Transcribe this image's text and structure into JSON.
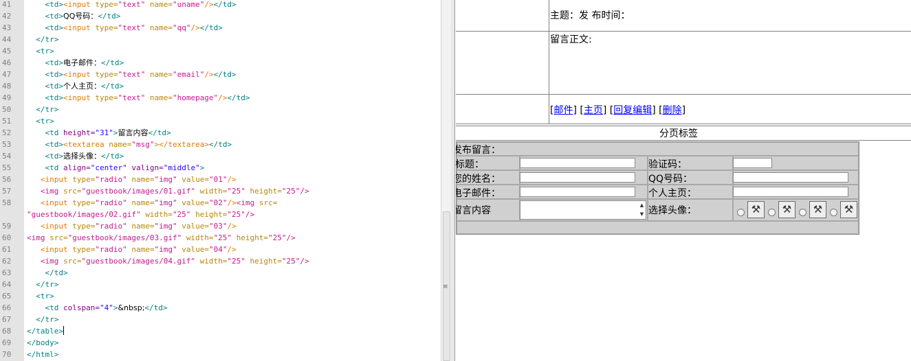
{
  "editor": {
    "lines": [
      {
        "num": "41",
        "segs": [
          [
            "t",
            "    <td>"
          ],
          [
            "ti",
            "<input "
          ],
          [
            "ta",
            "type="
          ],
          [
            "tv",
            "\"text\" "
          ],
          [
            "ta",
            "name="
          ],
          [
            "tv",
            "\"uname\""
          ],
          [
            "ti",
            "/>"
          ],
          [
            "t",
            "</td>"
          ]
        ]
      },
      {
        "num": "42",
        "segs": [
          [
            "t",
            "    <td>"
          ],
          [
            "x",
            "QQ号码："
          ],
          [
            "t",
            "</td>"
          ]
        ]
      },
      {
        "num": "43",
        "segs": [
          [
            "t",
            "    <td>"
          ],
          [
            "ti",
            "<input "
          ],
          [
            "ta",
            "type="
          ],
          [
            "tv",
            "\"text\" "
          ],
          [
            "ta",
            "name="
          ],
          [
            "tv",
            "\"qq\""
          ],
          [
            "ti",
            "/>"
          ],
          [
            "t",
            "</td>"
          ]
        ]
      },
      {
        "num": "44",
        "segs": [
          [
            "t",
            "  </tr>"
          ]
        ]
      },
      {
        "num": "45",
        "segs": [
          [
            "t",
            "  <tr>"
          ]
        ]
      },
      {
        "num": "46",
        "segs": [
          [
            "t",
            "    <td>"
          ],
          [
            "x",
            "电子邮件："
          ],
          [
            "t",
            "</td>"
          ]
        ]
      },
      {
        "num": "47",
        "segs": [
          [
            "t",
            "    <td>"
          ],
          [
            "ti",
            "<input "
          ],
          [
            "ta",
            "type="
          ],
          [
            "tv",
            "\"text\" "
          ],
          [
            "ta",
            "name="
          ],
          [
            "tv",
            "\"email\""
          ],
          [
            "ti",
            "/>"
          ],
          [
            "t",
            "</td>"
          ]
        ]
      },
      {
        "num": "48",
        "segs": [
          [
            "t",
            "    <td>"
          ],
          [
            "x",
            "个人主页："
          ],
          [
            "t",
            "</td>"
          ]
        ]
      },
      {
        "num": "49",
        "segs": [
          [
            "t",
            "    <td>"
          ],
          [
            "ti",
            "<input "
          ],
          [
            "ta",
            "type="
          ],
          [
            "tv",
            "\"text\" "
          ],
          [
            "ta",
            "name="
          ],
          [
            "tv",
            "\"homepage\""
          ],
          [
            "ti",
            "/>"
          ],
          [
            "t",
            "</td>"
          ]
        ]
      },
      {
        "num": "50",
        "segs": [
          [
            "t",
            "  </tr>"
          ]
        ]
      },
      {
        "num": "51",
        "segs": [
          [
            "t",
            "  <tr>"
          ]
        ]
      },
      {
        "num": "52",
        "segs": [
          [
            "t",
            "    <td "
          ],
          [
            "a",
            "height="
          ],
          [
            "v",
            "\"31\""
          ],
          [
            "t",
            ">"
          ],
          [
            "x",
            "留言内容"
          ],
          [
            "t",
            "</td>"
          ]
        ]
      },
      {
        "num": "53",
        "segs": [
          [
            "t",
            "    <td>"
          ],
          [
            "ti",
            "<textarea "
          ],
          [
            "ta",
            "name="
          ],
          [
            "tv",
            "\"msg\""
          ],
          [
            "ti",
            "></textarea>"
          ],
          [
            "t",
            "</td>"
          ]
        ]
      },
      {
        "num": "54",
        "segs": [
          [
            "t",
            "    <td>"
          ],
          [
            "x",
            "选择头像："
          ],
          [
            "t",
            "</td>"
          ]
        ]
      },
      {
        "num": "55",
        "segs": [
          [
            "t",
            "    <td "
          ],
          [
            "a",
            "align="
          ],
          [
            "v",
            "\"center\" "
          ],
          [
            "a",
            "valign="
          ],
          [
            "v",
            "\"middle\""
          ],
          [
            "t",
            ">"
          ]
        ]
      },
      {
        "num": "56",
        "segs": [
          [
            "ti",
            "   <input "
          ],
          [
            "ta",
            "type="
          ],
          [
            "tv",
            "\"radio\" "
          ],
          [
            "ta",
            "name="
          ],
          [
            "tv",
            "\"img\" "
          ],
          [
            "ta",
            "value="
          ],
          [
            "tv",
            "\"01\""
          ],
          [
            "ti",
            "/>"
          ]
        ]
      },
      {
        "num": "57",
        "segs": [
          [
            "tv",
            "   <img "
          ],
          [
            "ta",
            "src="
          ],
          [
            "tv",
            "\"guestbook/images/01.gif\" "
          ],
          [
            "ta",
            "width="
          ],
          [
            "tv",
            "\"25\" "
          ],
          [
            "ta",
            "height="
          ],
          [
            "tv",
            "\"25\""
          ],
          [
            "tv",
            "/>"
          ]
        ]
      },
      {
        "num": "58",
        "segs": [
          [
            "ti",
            "   <input "
          ],
          [
            "ta",
            "type="
          ],
          [
            "tv",
            "\"radio\" "
          ],
          [
            "ta",
            "name="
          ],
          [
            "tv",
            "\"img\" "
          ],
          [
            "ta",
            "value="
          ],
          [
            "tv",
            "\"02\""
          ],
          [
            "ti",
            "/>"
          ],
          [
            "tv",
            "<img "
          ],
          [
            "ta",
            "src="
          ]
        ]
      },
      {
        "num": "",
        "segs": [
          [
            "tv",
            "\"guestbook/images/02.gif\" "
          ],
          [
            "ta",
            "width="
          ],
          [
            "tv",
            "\"25\" "
          ],
          [
            "ta",
            "height="
          ],
          [
            "tv",
            "\"25\""
          ],
          [
            "tv",
            "/>"
          ]
        ]
      },
      {
        "num": "59",
        "segs": [
          [
            "ti",
            "   <input "
          ],
          [
            "ta",
            "type="
          ],
          [
            "tv",
            "\"radio\" "
          ],
          [
            "ta",
            "name="
          ],
          [
            "tv",
            "\"img\" "
          ],
          [
            "ta",
            "value="
          ],
          [
            "tv",
            "\"03\""
          ],
          [
            "ti",
            "/>"
          ]
        ]
      },
      {
        "num": "60",
        "segs": [
          [
            "tv",
            "<img "
          ],
          [
            "ta",
            "src="
          ],
          [
            "tv",
            "\"guestbook/images/03.gif\" "
          ],
          [
            "ta",
            "width="
          ],
          [
            "tv",
            "\"25\" "
          ],
          [
            "ta",
            "height="
          ],
          [
            "tv",
            "\"25\""
          ],
          [
            "tv",
            "/>"
          ]
        ]
      },
      {
        "num": "61",
        "segs": [
          [
            "ti",
            "   <input "
          ],
          [
            "ta",
            "type="
          ],
          [
            "tv",
            "\"radio\" "
          ],
          [
            "ta",
            "name="
          ],
          [
            "tv",
            "\"img\" "
          ],
          [
            "ta",
            "value="
          ],
          [
            "tv",
            "\"04\""
          ],
          [
            "ti",
            "/>"
          ]
        ]
      },
      {
        "num": "62",
        "segs": [
          [
            "tv",
            "   <img "
          ],
          [
            "ta",
            "src="
          ],
          [
            "tv",
            "\"guestbook/images/04.gif\" "
          ],
          [
            "ta",
            "width="
          ],
          [
            "tv",
            "\"25\" "
          ],
          [
            "ta",
            "height="
          ],
          [
            "tv",
            "\"25\""
          ],
          [
            "tv",
            "/>"
          ]
        ]
      },
      {
        "num": "63",
        "segs": [
          [
            "t",
            "    </td>"
          ]
        ]
      },
      {
        "num": "64",
        "segs": [
          [
            "t",
            "  </tr>"
          ]
        ]
      },
      {
        "num": "65",
        "segs": [
          [
            "t",
            "  <tr>"
          ]
        ]
      },
      {
        "num": "66",
        "segs": [
          [
            "t",
            "    <td "
          ],
          [
            "a",
            "colspan="
          ],
          [
            "v",
            "\"4\""
          ],
          [
            "t",
            ">"
          ],
          [
            "x",
            "&nbsp;"
          ],
          [
            "t",
            "</td>"
          ]
        ]
      },
      {
        "num": "67",
        "segs": [
          [
            "t",
            "  </tr>"
          ]
        ]
      },
      {
        "num": "68",
        "segs": [
          [
            "t",
            "</table>"
          ]
        ],
        "caret": true
      },
      {
        "num": "69",
        "segs": [
          [
            "t",
            "</body>"
          ]
        ]
      },
      {
        "num": "70",
        "segs": [
          [
            "t",
            "</html>"
          ]
        ]
      }
    ]
  },
  "preview": {
    "subject_line": "主题：发 布时间：",
    "body_label": "留言正文:",
    "actions": [
      {
        "bracket_open": "[",
        "label": "邮件",
        "bracket_close": "]"
      },
      {
        "bracket_open": " [",
        "label": "主页",
        "bracket_close": "]"
      },
      {
        "bracket_open": " [",
        "label": "回复",
        "bracket_close": ""
      },
      {
        "bracket_open": "",
        "label": "编辑",
        "bracket_close": "]"
      },
      {
        "bracket_open": " [",
        "label": "删除",
        "bracket_close": "]"
      }
    ],
    "pagination_label": "分页标签",
    "form": {
      "header": "发布留言：",
      "title_label": "标题：",
      "captcha_label": "验证码：",
      "name_label": "您的姓名：",
      "qq_label": "QQ号码：",
      "email_label": "电子邮件：",
      "homepage_label": "个人主页：",
      "message_label": "留言内容",
      "avatar_label": "选择头像：",
      "avatar_options": [
        "01",
        "02",
        "03",
        "04"
      ]
    }
  },
  "scrollbar": {
    "grip": "≡"
  }
}
